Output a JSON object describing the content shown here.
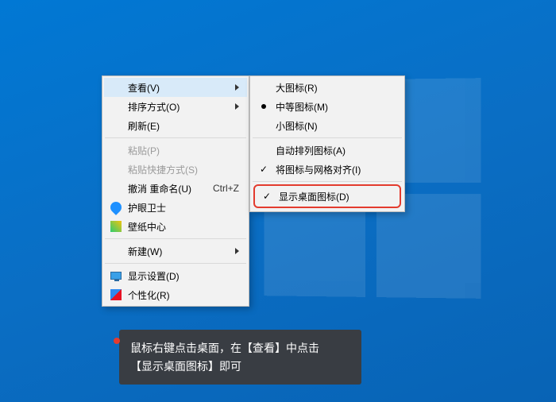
{
  "main_menu": {
    "view": {
      "label": "查看(V)"
    },
    "sort": {
      "label": "排序方式(O)"
    },
    "refresh": {
      "label": "刷新(E)"
    },
    "paste": {
      "label": "粘贴(P)"
    },
    "paste_short": {
      "label": "粘贴快捷方式(S)"
    },
    "undo": {
      "label": "撤消 重命名(U)",
      "shortcut": "Ctrl+Z"
    },
    "eye_guard": {
      "label": "护眼卫士"
    },
    "wallpaper": {
      "label": "壁纸中心"
    },
    "new": {
      "label": "新建(W)"
    },
    "display": {
      "label": "显示设置(D)"
    },
    "personalize": {
      "label": "个性化(R)"
    }
  },
  "sub_menu": {
    "large": {
      "label": "大图标(R)"
    },
    "medium": {
      "label": "中等图标(M)"
    },
    "small": {
      "label": "小图标(N)"
    },
    "auto": {
      "label": "自动排列图标(A)"
    },
    "align": {
      "label": "将图标与网格对齐(I)"
    },
    "show": {
      "label": "显示桌面图标(D)"
    }
  },
  "tooltip": {
    "line1": "鼠标右键点击桌面，在【查看】中点击",
    "line2": "【显示桌面图标】即可"
  }
}
